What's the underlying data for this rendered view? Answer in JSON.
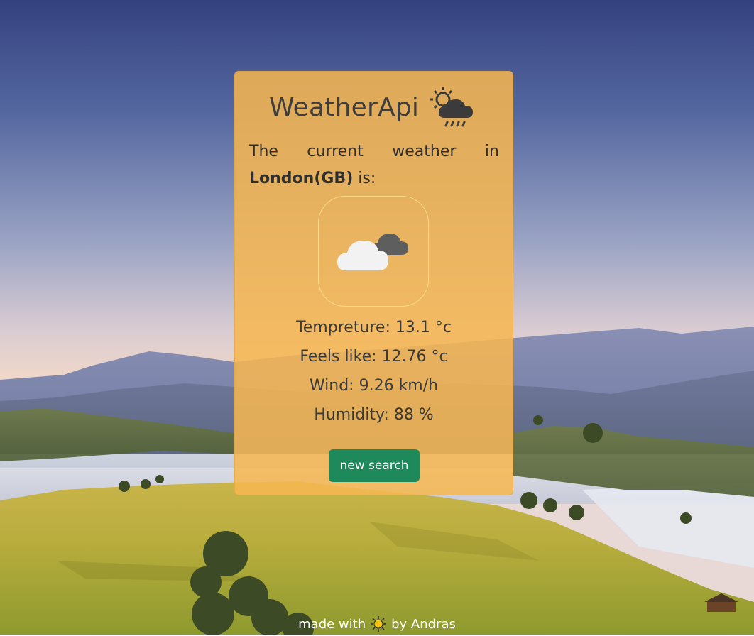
{
  "card": {
    "title": "WeatherApi",
    "intro_words": [
      "The",
      "current",
      "weather",
      "in"
    ],
    "city": "London(GB)",
    "intro_suffix": " is:",
    "stats": {
      "temperature": "Tempreture: 13.1 °c",
      "feels_like": "Feels like: 12.76 °c",
      "wind": "Wind: 9.26 km/h",
      "humidity": "Humidity: 88 %"
    },
    "button_label": "new search",
    "title_icon": "sun-cloud-rain-icon",
    "condition_icon": "broken-clouds-icon"
  },
  "footer": {
    "prefix": "made with",
    "icon": "sun-icon",
    "suffix": "by Andras"
  },
  "colors": {
    "card": "#f7b750",
    "button": "#1e8a5c",
    "sky_top": "#3b4a86",
    "hill": "#b8b03a"
  }
}
